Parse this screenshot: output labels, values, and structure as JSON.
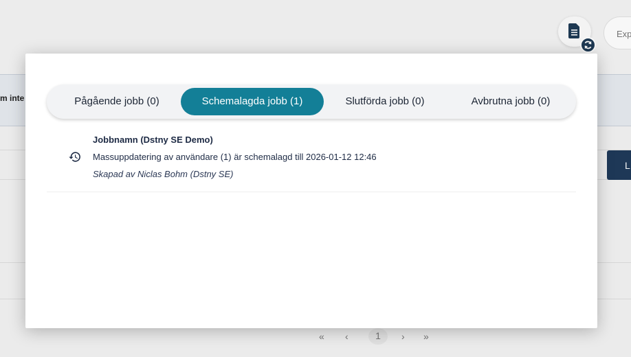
{
  "background": {
    "column_header_fragment": "m inte",
    "export_placeholder": "Exp",
    "right_button_label": "L",
    "pagination": {
      "first": "«",
      "prev": "‹",
      "current_page": "1",
      "next": "›",
      "last": "»"
    }
  },
  "modal": {
    "tabs": [
      {
        "label": "Pågående jobb (0)",
        "active": false
      },
      {
        "label": "Schemalagda jobb (1)",
        "active": true
      },
      {
        "label": "Slutförda jobb (0)",
        "active": false
      },
      {
        "label": "Avbrutna jobb (0)",
        "active": false
      }
    ],
    "jobs": [
      {
        "icon": "history-icon",
        "name": "Jobbnamn (Dstny SE Demo)",
        "description": "Massuppdatering av användare (1) är schemalagd till 2026-01-12 12:46",
        "created_by": "Skapad av Niclas Bohm (Dstny SE)"
      }
    ]
  },
  "colors": {
    "accent": "#137f97",
    "navy": "#1e3a55"
  }
}
